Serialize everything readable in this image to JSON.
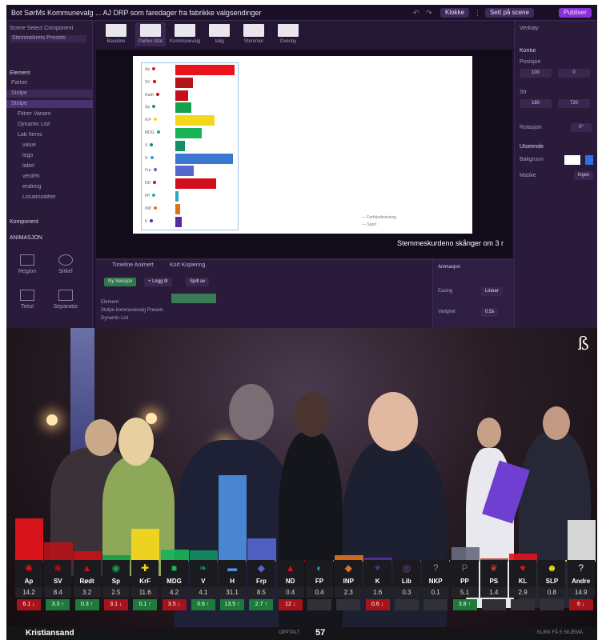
{
  "editor": {
    "window_title": "Bot SørMs Kommunevalg ... AJ DRP som faredager fra fabrikke valgsendinger",
    "toolbar": {
      "btn1": "Klokke",
      "btn2": "Sett på scene",
      "btn3": "Publiser"
    },
    "left_panel": {
      "title": "Scene Select Component",
      "dropdown": "Stemmekrets Presets",
      "section_layers": "Element",
      "layers": [
        "Partier",
        "Stolpe",
        "Stolpe",
        "Filtrer Variant",
        "Dynamic List",
        "Lab Items",
        "value",
        "logo",
        "label",
        "verdi%",
        "endring",
        "Localmodifier"
      ],
      "section_assets": "Komponent",
      "section_tools": "ANIMASJON",
      "tools": [
        "Region",
        "Sirkel",
        "Tekst",
        "Separator"
      ]
    },
    "tabs": [
      "Baseline",
      "Partier-Stat",
      "Kommunevalg",
      "Valg",
      "Stemmer",
      "Overlay"
    ],
    "preview": {
      "mini_labels": [
        "Ap",
        "SV",
        "Rødt",
        "Sp",
        "KrF",
        "MDG",
        "V",
        "H",
        "Frp",
        "ND",
        "FP",
        "INP",
        "K"
      ],
      "ticker": "Stemmeskurdeno skånger om 3 r",
      "legend1": "Forhåndsvisning",
      "legend2": "Sport"
    },
    "right_panel": {
      "title": "Verktøy",
      "section1": "Kontur",
      "lbl_position": "Posisjon",
      "lbl_size": "Str",
      "lbl_rotation": "Rotasjon",
      "lbl_appearance": "Utseende",
      "lbl_background": "Bakgrunn",
      "lbl_mask": "Maske",
      "field_x": "100",
      "field_y": "0",
      "field_w": "180",
      "field_h": "720",
      "field_rot": "0°",
      "field_mask": "Ingen"
    },
    "bottom_panel": {
      "tab1": "Timeline Animert",
      "tab2": "Kort Kopiering",
      "btn_new": "Ny Seksjon",
      "btn_add": "+ Legg til",
      "btn_play": "Spill av",
      "row1": "Element",
      "row2": "Stolpe kommunevalg Presets",
      "row3": "Dynamic List",
      "prop_title": "Animasjon",
      "prop_label1": "Easing",
      "prop_value1": "Linear",
      "prop_label2": "Varighet",
      "prop_value2": "0.5s"
    }
  },
  "broadcast": {
    "logo_glyph": "ß",
    "location": "Kristiansand",
    "count_label": "OPPTALT",
    "count": "57",
    "right_label": "KLIKK FÅ 5 SKJEMA",
    "parties": [
      {
        "logo": "❀",
        "abbr": "Ap",
        "pct": "14.2",
        "chg": "6.1 ↓",
        "dir": "down",
        "color": "#e8141c",
        "height": 0.5
      },
      {
        "logo": "❀",
        "abbr": "SV",
        "pct": "8.4",
        "chg": "3.3 ↑",
        "dir": "up",
        "color": "#b4131a",
        "height": 0.22
      },
      {
        "logo": "▲",
        "abbr": "Rødt",
        "pct": "3.2",
        "chg": "0.3 ↑",
        "dir": "up",
        "color": "#c8101a",
        "height": 0.12
      },
      {
        "logo": "◉",
        "abbr": "Sp",
        "pct": "2.5",
        "chg": "3.1 ↓",
        "dir": "down",
        "color": "#15a04a",
        "height": 0.07
      },
      {
        "logo": "✚",
        "abbr": "KrF",
        "pct": "11.6",
        "chg": "0.1 ↑",
        "dir": "up",
        "color": "#f4d71a",
        "height": 0.38
      },
      {
        "logo": "■",
        "abbr": "MDG",
        "pct": "4.2",
        "chg": "3.5 ↓",
        "dir": "down",
        "color": "#19b357",
        "height": 0.14
      },
      {
        "logo": "❧",
        "abbr": "V",
        "pct": "4.1",
        "chg": "0.6 ↑",
        "dir": "up",
        "color": "#138f63",
        "height": 0.13
      },
      {
        "logo": "▬",
        "abbr": "H",
        "pct": "31.1",
        "chg": "13.5 ↑",
        "dir": "up",
        "color": "#4e8ee0",
        "height": 1.0
      },
      {
        "logo": "◆",
        "abbr": "Frp",
        "pct": "8.5",
        "chg": "2.7 ↑",
        "dir": "up",
        "color": "#5566cc",
        "height": 0.27
      },
      {
        "logo": "▲",
        "abbr": "ND",
        "pct": "0.4",
        "chg": "12 ↓",
        "dir": "down",
        "color": "#d0101a",
        "height": 0.02
      },
      {
        "logo": "◐",
        "abbr": "FP",
        "pct": "0.4",
        "chg": "",
        "dir": "flat",
        "color": "#2aa8c8",
        "height": 0.02
      },
      {
        "logo": "◆",
        "abbr": "INP",
        "pct": "2.3",
        "chg": "",
        "dir": "flat",
        "color": "#e0701a",
        "height": 0.07
      },
      {
        "logo": "✦",
        "abbr": "K",
        "pct": "1.6",
        "chg": "0.6 ↓",
        "dir": "down",
        "color": "#5a2aa0",
        "height": 0.05
      },
      {
        "logo": "◎",
        "abbr": "Lib",
        "pct": "0.3",
        "chg": "",
        "dir": "flat",
        "color": "#9a3ac0",
        "height": 0.01
      },
      {
        "logo": "?",
        "abbr": "NKP",
        "pct": "0.1",
        "chg": "",
        "dir": "flat",
        "color": "#888888",
        "height": 0.005
      },
      {
        "logo": "P",
        "abbr": "PP",
        "pct": "5.1",
        "chg": "3.8 ↑",
        "dir": "up",
        "color": "#6a6a80",
        "height": 0.17
      },
      {
        "logo": "❦",
        "abbr": "PS",
        "pct": "1.4",
        "chg": "",
        "dir": "flat",
        "color": "#c03a2a",
        "height": 0.04
      },
      {
        "logo": "♥",
        "abbr": "KL",
        "pct": "2.9",
        "chg": "",
        "dir": "flat",
        "color": "#e0141c",
        "height": 0.09
      },
      {
        "logo": "☻",
        "abbr": "SLP",
        "pct": "0.8",
        "chg": "",
        "dir": "flat",
        "color": "#e6e61a",
        "height": 0.02
      },
      {
        "logo": "?",
        "abbr": "Andre",
        "pct": "14.9",
        "chg": "6 ↓",
        "dir": "down",
        "color": "#e6e6e6",
        "height": 0.48
      }
    ]
  }
}
